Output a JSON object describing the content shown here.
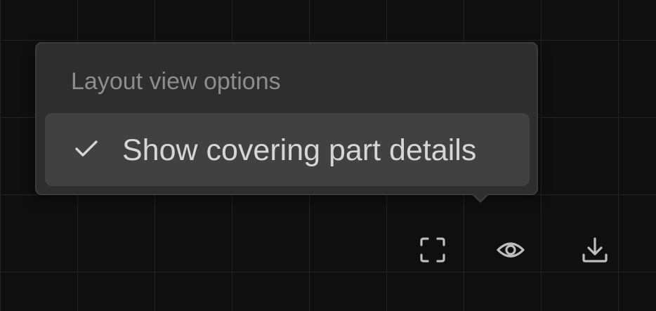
{
  "popover": {
    "heading": "Layout view options",
    "option": {
      "label": "Show covering part details",
      "checked": true,
      "icon": "check-icon"
    }
  },
  "toolbar": {
    "buttons": [
      {
        "icon": "fit-to-screen-icon"
      },
      {
        "icon": "eye-icon",
        "active": true
      },
      {
        "icon": "download-icon"
      }
    ]
  },
  "colors": {
    "background": "#0f0f0f",
    "grid": "#232323",
    "popover": "#2e2e2e",
    "option_hover": "#414141",
    "text_primary": "#d6d6d6",
    "text_secondary": "#8d8d8d",
    "icon": "#bdbdbd"
  }
}
